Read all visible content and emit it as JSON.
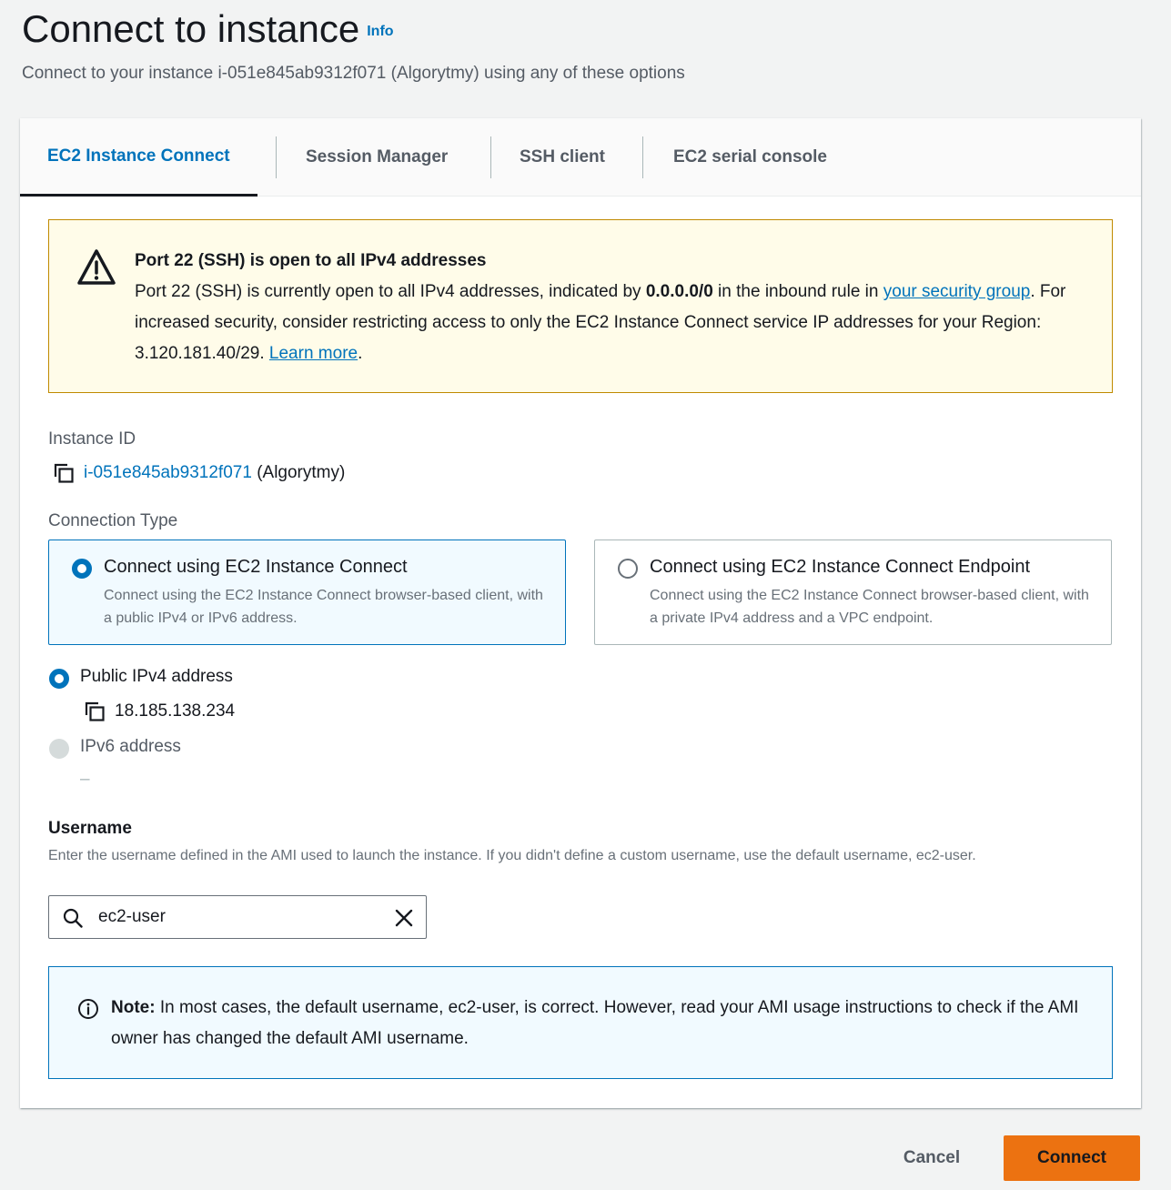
{
  "header": {
    "title": "Connect to instance",
    "info_label": "Info",
    "subtitle": "Connect to your instance i-051e845ab9312f071 (Algorytmy) using any of these options"
  },
  "tabs": [
    {
      "label": "EC2 Instance Connect",
      "active": true
    },
    {
      "label": "Session Manager",
      "active": false
    },
    {
      "label": "SSH client",
      "active": false
    },
    {
      "label": "EC2 serial console",
      "active": false
    }
  ],
  "warning": {
    "title": "Port 22 (SSH) is open to all IPv4 addresses",
    "body_1": "Port 22 (SSH) is currently open to all IPv4 addresses, indicated by ",
    "body_bold": "0.0.0.0/0",
    "body_2": " in the inbound rule in ",
    "link_security_group": "your security group",
    "body_3": ". For increased security, consider restricting access to only the EC2 Instance Connect service IP addresses for your Region: 3.120.181.40/29. ",
    "link_learn_more": "Learn more",
    "body_4": "."
  },
  "instance": {
    "label": "Instance ID",
    "id": "i-051e845ab9312f071",
    "name": "(Algorytmy)"
  },
  "connection_type": {
    "label": "Connection Type",
    "options": [
      {
        "title": "Connect using EC2 Instance Connect",
        "description": "Connect using the EC2 Instance Connect browser-based client, with a public IPv4 or IPv6 address.",
        "selected": true
      },
      {
        "title": "Connect using EC2 Instance Connect Endpoint",
        "description": "Connect using the EC2 Instance Connect browser-based client, with a private IPv4 address and a VPC endpoint.",
        "selected": false
      }
    ]
  },
  "address": {
    "public_ipv4_label": "Public IPv4 address",
    "public_ipv4_value": "18.185.138.234",
    "ipv6_label": "IPv6 address",
    "ipv6_value": "–"
  },
  "username": {
    "title": "Username",
    "description": "Enter the username defined in the AMI used to launch the instance. If you didn't define a custom username, use the default username, ec2-user.",
    "value": "ec2-user"
  },
  "note": {
    "bold": "Note:",
    "text": " In most cases, the default username, ec2-user, is correct. However, read your AMI usage instructions to check if the AMI owner has changed the default AMI username."
  },
  "footer": {
    "cancel_label": "Cancel",
    "connect_label": "Connect"
  },
  "colors": {
    "link": "#0073bb",
    "warning_bg": "#fffce9",
    "warning_border": "#c08a00",
    "info_bg": "#f1faff",
    "primary_button": "#ec7211"
  }
}
